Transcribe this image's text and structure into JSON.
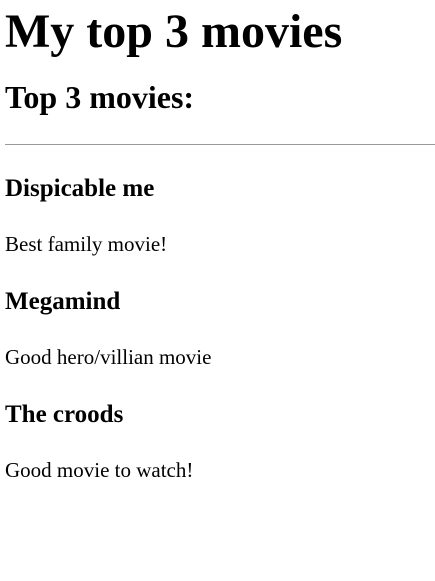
{
  "page": {
    "title": "My top 3 movies",
    "subtitle": "Top 3 movies:"
  },
  "movies": [
    {
      "title": "Dispicable me",
      "description": "Best family movie!"
    },
    {
      "title": "Megamind",
      "description": "Good hero/villian movie"
    },
    {
      "title": "The croods",
      "description": "Good movie to watch!"
    }
  ]
}
